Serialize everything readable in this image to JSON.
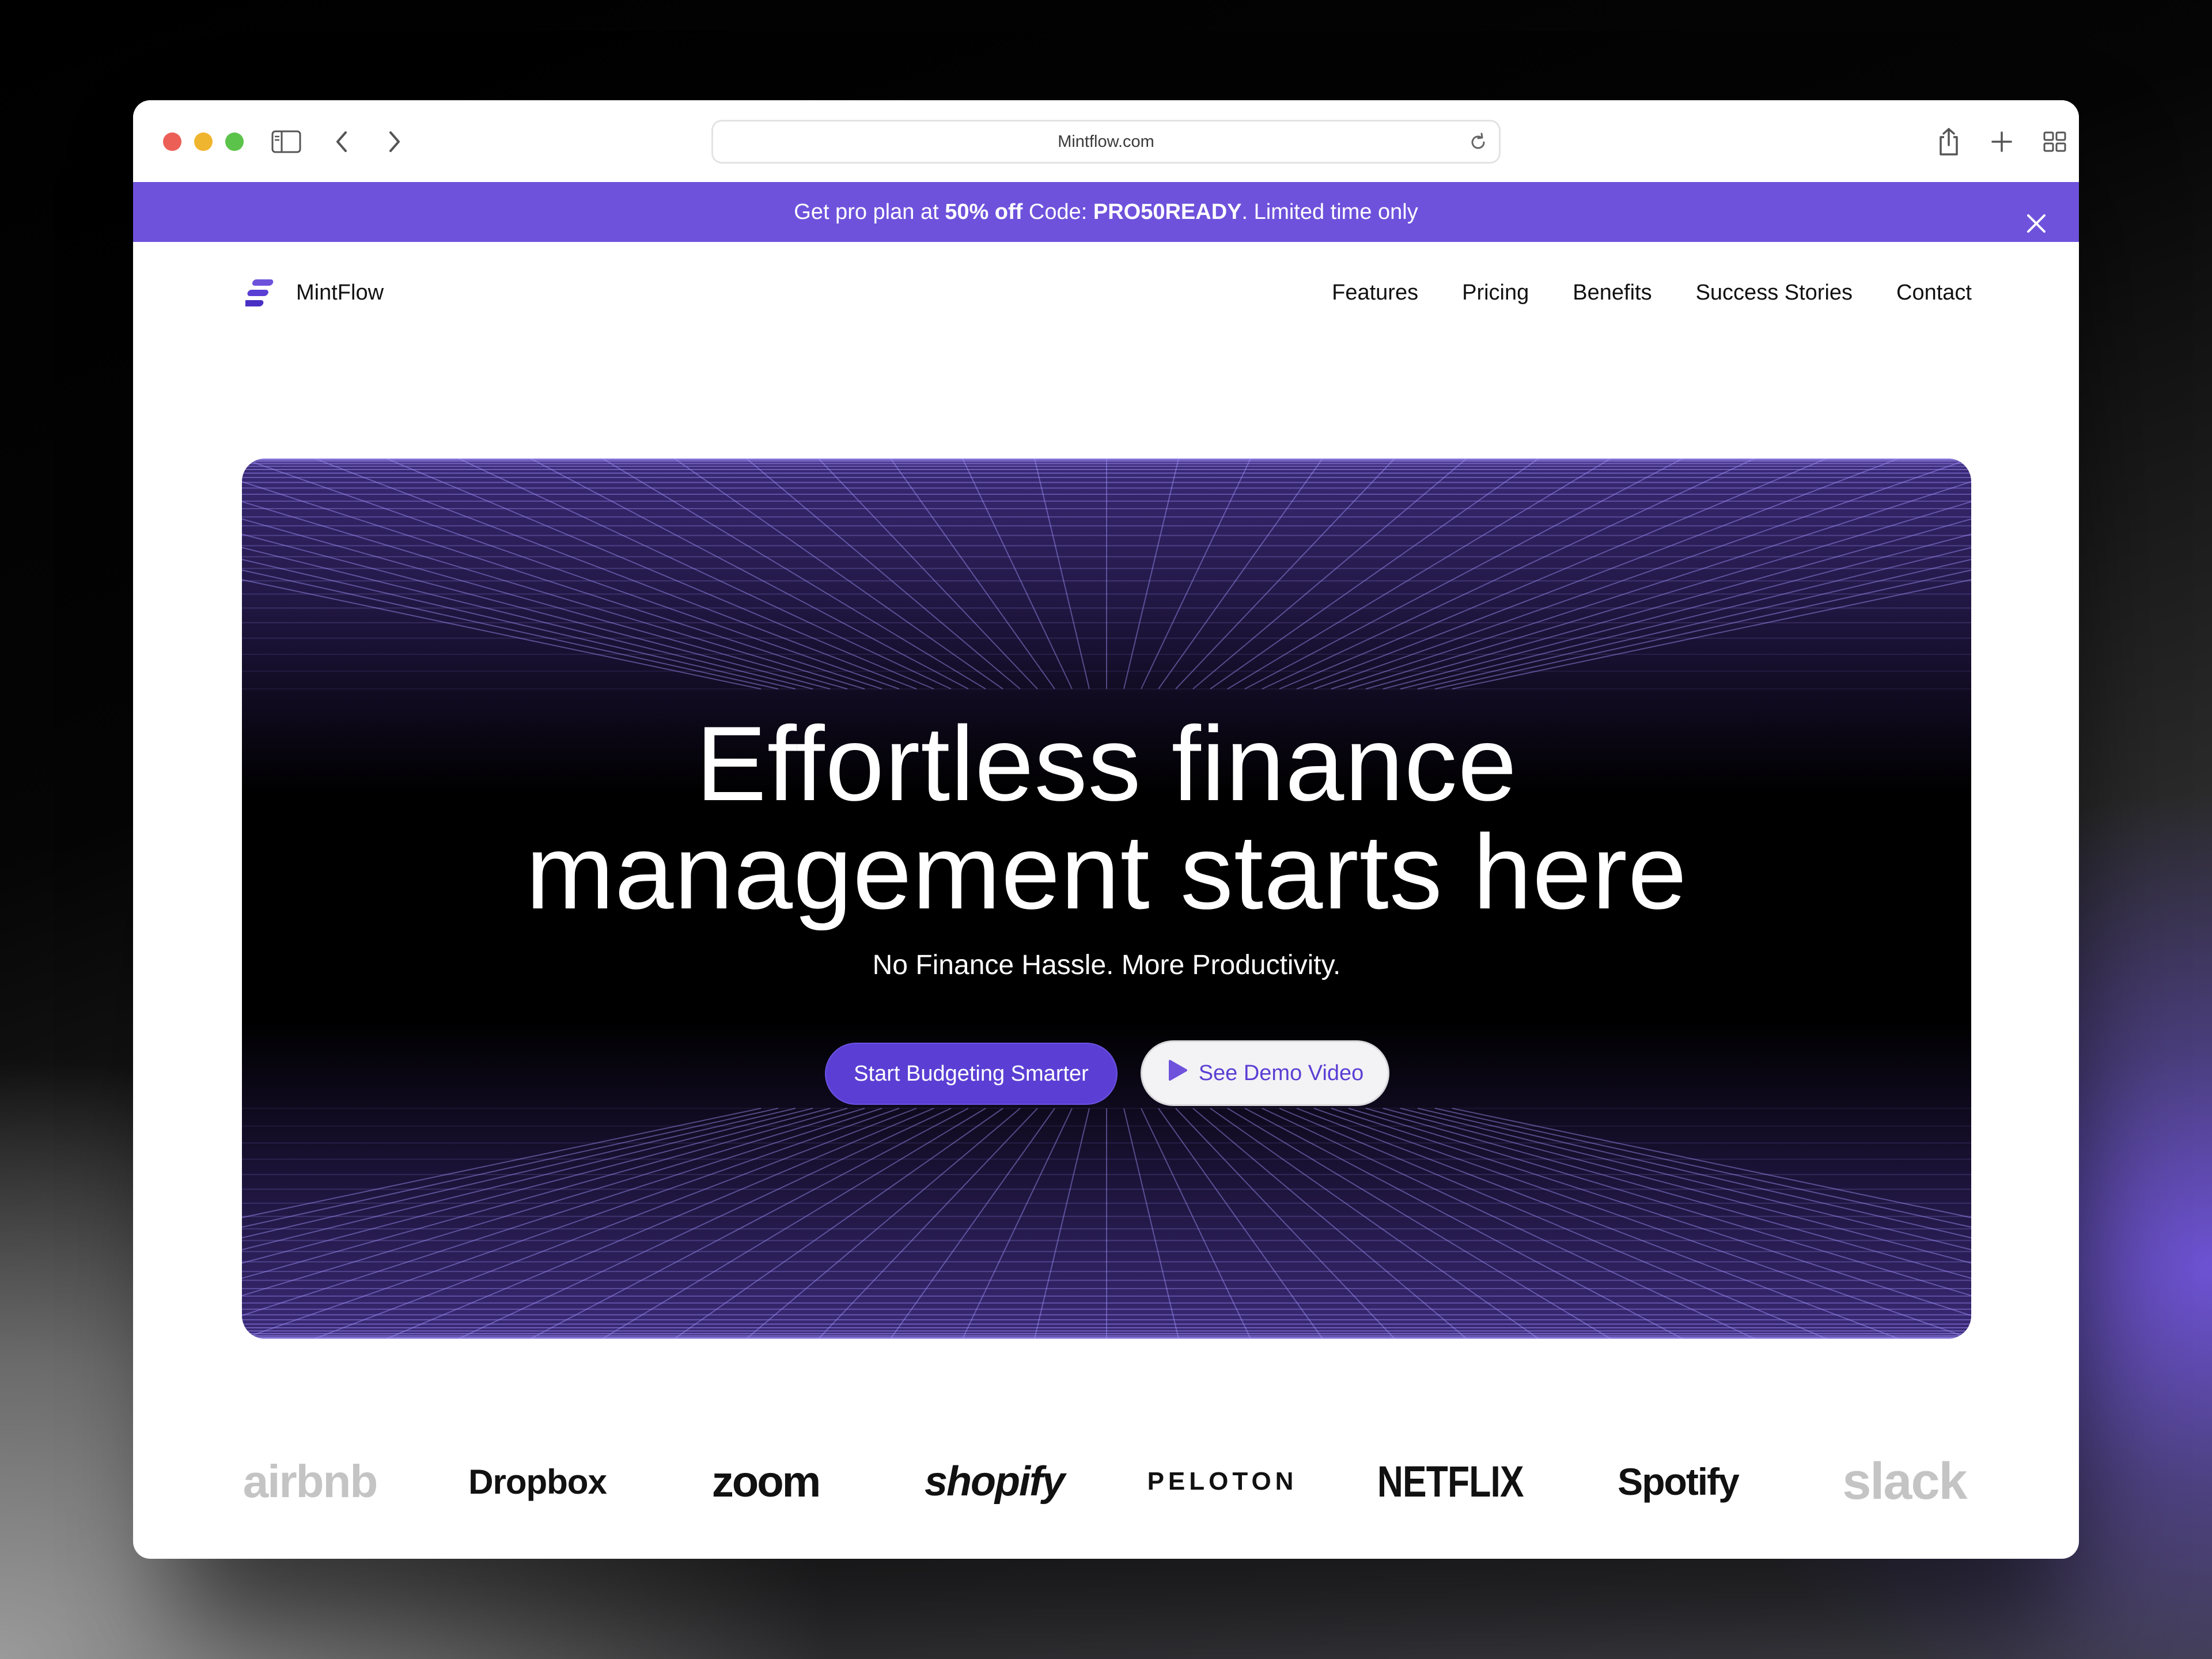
{
  "browser": {
    "url": "Mintflow.com"
  },
  "banner": {
    "text_before": "Get pro plan at ",
    "discount": "50% off",
    "text_code_label": " Code: ",
    "code": "PRO50READY",
    "text_after": ". Limited time only"
  },
  "nav": {
    "brand": "MintFlow",
    "links": [
      "Features",
      "Pricing",
      "Benefits",
      "Success Stories",
      "Contact"
    ]
  },
  "hero": {
    "title_line1": "Effortless finance",
    "title_line2": "management starts here",
    "subtitle": "No Finance Hassle. More Productivity.",
    "primary_cta": "Start Budgeting Smarter",
    "secondary_cta": "See Demo Video"
  },
  "logos": [
    "airbnb",
    "Dropbox",
    "zoom",
    "shopify",
    "PELOTON",
    "NETFLIX",
    "Spotify",
    "slack"
  ],
  "colors": {
    "accent": "#6e52dc",
    "button_primary": "#5b3fd4"
  }
}
